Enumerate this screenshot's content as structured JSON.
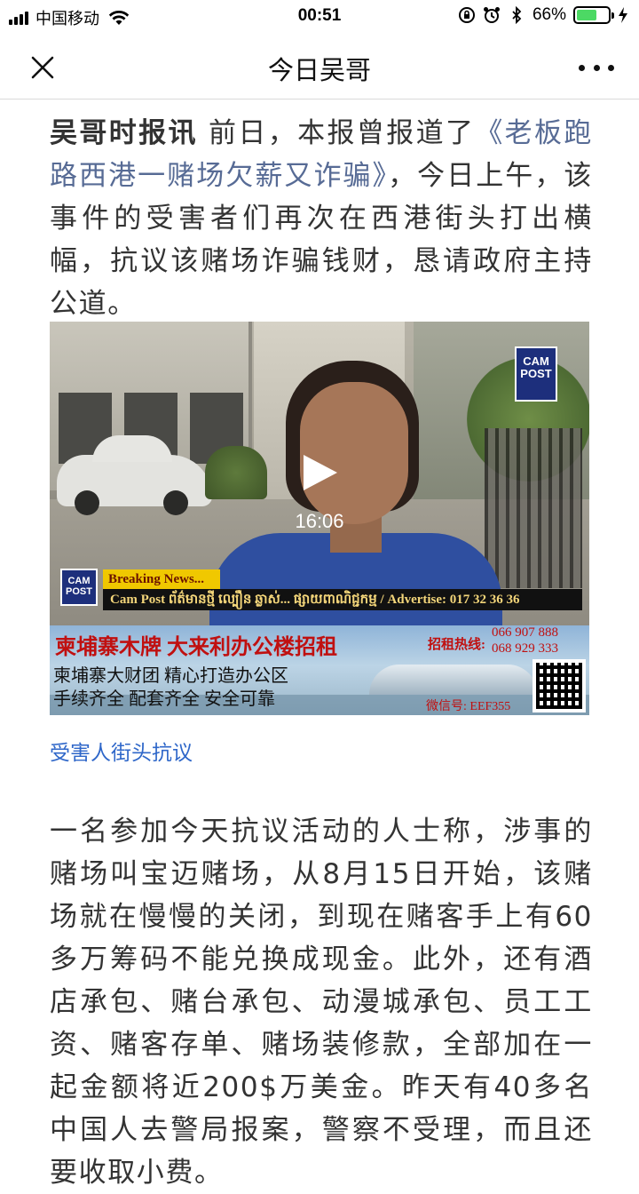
{
  "status_bar": {
    "carrier": "中国移动",
    "time": "00:51",
    "battery_percent": "66%",
    "battery_level": 0.66,
    "battery_color": "#4cd964"
  },
  "nav": {
    "title": "今日吴哥",
    "close_icon": "close-icon",
    "more_icon": "more-icon"
  },
  "article": {
    "lead_bold": "吴哥时报讯",
    "lead_text_1": " 前日，本报曾报道了",
    "lead_link": "《老板跑路西港一赌场欠薪又诈骗》",
    "lead_text_2": "，今日上午，该事件的受害者们再次在西港街头打出横幅，抗议该赌场诈骗钱财，恳请政府主持公道。",
    "link_color": "#576b95",
    "video": {
      "duration": "16:06",
      "logo_text": "CAM POST",
      "breaking": "Breaking News...",
      "ticker": "Cam Post ព័ត៌មានថ្មី ល្បឿន ឆ្លាស់... ផ្សាយពាណិជ្ជកម្ម / Advertise: 017 32 36 36",
      "ad": {
        "title": "柬埔寨木牌 大来利办公楼招租",
        "hotline_label": "招租热线:",
        "phone1": "066 907 888",
        "phone2": "068 929 333",
        "line1": "柬埔寨大财团 精心打造办公区",
        "line2": "手续齐全 配套齐全 安全可靠",
        "wechat": "微信号: EEF355"
      }
    },
    "caption": "受害人街头抗议",
    "caption_color": "#2f67c9",
    "body": "一名参加今天抗议活动的人士称，涉事的赌场叫宝迈赌场，从8月15日开始，该赌场就在慢慢的关闭，到现在赌客手上有60多万筹码不能兑换成现金。此外，还有酒店承包、赌台承包、动漫城承包、员工工资、赌客存单、赌场装修款，全部加在一起金额将近200$万美金。昨天有40多名中国人去警局报案，警察不受理，而且还要收取小费。"
  }
}
